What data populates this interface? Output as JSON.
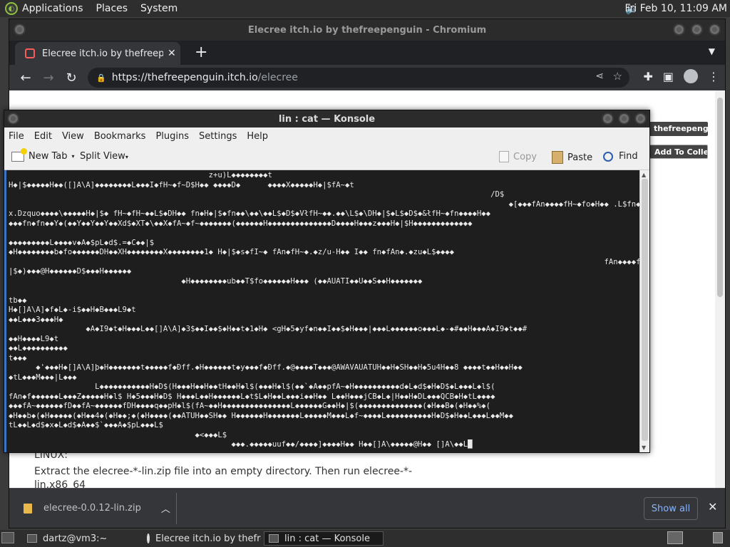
{
  "top_panel": {
    "menus": [
      "Applications",
      "Places",
      "System"
    ],
    "clock": "Fri Feb 10, 11:09 AM",
    "volume_icon": "speaker-icon"
  },
  "chrome": {
    "window_title": "Elecree itch.io by thefreepenguin - Chromium",
    "tab_title": "Elecree itch.io by thefreepenguin",
    "url_host": "https://thefreepenguin.itch.io",
    "url_path": "/elecree",
    "page": {
      "owner_button": "thefreepenguin",
      "collection_button": "Add To Collection",
      "linux_heading": "LINUX:",
      "extract_text": "Extract the elecree-*-lin.zip file into an empty directory. Then run elecree-*-lin.x86_64"
    },
    "downloads": {
      "file": "elecree-0.0.12-lin.zip",
      "show_all": "Show all"
    }
  },
  "konsole": {
    "title": "lin : cat — Konsole",
    "menu": [
      "File",
      "Edit",
      "View",
      "Bookmarks",
      "Plugins",
      "Settings",
      "Help"
    ],
    "toolbar": {
      "new_tab": "New Tab",
      "split_view": "Split View",
      "copy": "Copy",
      "paste": "Paste",
      "find": "Find"
    },
    "terminal_lines": [
      "                                            z+u)L◆◆◆◆◆◆◆◆t",
      "H◆|$◆◆◆◆◆H◆◆([]A\\A]◆◆◆◆◆◆◆◆L◆◆◆I◆fH~◆f~D$H◆◆ ◆◆◆◆D◆      ◆◆◆◆X◆◆◆◆◆H◆|$fA~◆t",
      "                                                                                                          /D$",
      "                                                                                                              ◆[◆◆◆fAn◆◆◆◆fH~◆fo◆H◆◆ .L$fn◆zzu",
      "x.Dzquo◆◆◆◆\\◆◆◆◆◆H◆|$◆ fH~◆fH~◆◆L$◆DH◆◆ fn◆H◆|$◆fn◆◆\\◆◆\\◆◆L$◆D$◆VłfH~◆◆.◆◆\\L$◆\\DH◆|$◆L$◆D$◆&łfH~◆fn◆◆◆◆H◆◆",
      "◆◆◆fn◆fn◆◆Y◆(◆◆Y◆◆Y◆◆Y◆◆Xd$◆XT◆\\◆◆X◆fA~◆f~◆◆◆◆◆◆◆(◆◆◆◆◆◆H◆◆◆◆◆◆◆◆◆◆◆◆◆◆D◆◆◆◆H◆◆◆z◆◆◆H◆|$H◆◆◆◆◆◆◆◆◆◆◆◆◆",
      "                                                                                                                                            ◆◆◆H◆|$◆◆◆",
      "◆◆◆◆◆◆◆◆◆L◆◆◆◆v◆A◆$pL◆d$.=◆C◆◆|$",
      "◆H◆◆◆◆◆◆◆◆b◆fo◆◆◆◆◆◆DH◆◆XH◆◆◆◆◆◆◆◆X◆◆◆◆◆◆◆◆1◆ H◆|$◆s◆fI~◆ fAn◆fH~◆.◆z/u-H◆◆ I◆◆ fn◆fAn◆.◆zu◆L$◆◆◆◆",
      "                                                                                                                                   fAn◆◆◆◆fA~◆H◆",
      "|$◆)◆◆◆@H◆◆◆◆◆◆D$◆◆◆H◆◆◆◆◆◆",
      "                                      ◆H◆◆◆◆◆◆◆◆ub◆◆T$fo◆◆◆◆◆◆H◆◆◆ (◆◆AUATI◆◆U◆◆S◆◆H◆◆◆◆◆◆◆",
      "",
      "tb◆◆",
      "H◆[]A\\A]◆f◆L◆-i$◆◆H◆B◆◆◆L9◆t",
      "◆◆L◆◆◆3◆◆◆H◆",
      "                 ◆A◆I9◆t◆H◆◆◆L◆◆[]A\\A]◆3$◆◆I◆◆$◆H◆◆t◆1◆H◆ <gH◆5◆yf◆n◆◆I◆◆$◆H◆◆◆|◆◆◆L◆◆◆◆◆◆o◆◆◆L◆-◆#◆◆H◆◆◆A◆I9◆t◆◆#",
      "◆◆H◆◆◆◆L9◆t",
      "◆◆L◆◆◆◆◆◆◆◆◆◆",
      "t◆◆◆",
      "      ◆'◆◆◆H◆[]A\\A]þ◆H◆◆◆◆◆◆◆t◆◆◆◆◆f◆Ðff.◆H◆◆◆◆◆◆t◆y◆◆◆f◆Ðff.◆@◆◆◆◆T◆◆◆@AWAVAUATUH◆◆H◆SH◆◆H◆5u4H◆◆8 ◆◆◆◆t◆◆H◆◆H◆◆",
      "◆tL◆◆◆M◆◆◆|L◆◆◆",
      "                   L◆◆◆◆◆◆◆◆◆◆◆H◆D$(H◆◆◆H◆◆H◆◆tH◆◆H◆l$(◆◆◆H◆l$(◆◆`◆A◆◆pfA~◆H◆◆◆◆◆◆◆◆◆◆d◆L◆d$◆H◆D$◆L◆◆◆L◆l$(",
      "fAn◆f◆◆◆◆◆◆L◆◆◆Z◆◆◆◆◆H◆l$ H◆5◆◆◆H◆D$ H◆◆◆L◆◆H◆◆◆◆◆◆L◆t$L◆H◆◆L◆◆◆i◆◆H◆◆ L◆◆H◆◆◆jCB◆L◆|H◆◆H◆DL◆◆◆QCB◆H◆tL◆◆◆◆",
      "◆◆◆fA~◆◆◆◆◆◆fD◆◆fA~◆◆◆◆◆◆fDH◆◆◆◆q◆◆pH◆l$(fA~◆◆H◆◆◆◆◆◆◆◆◆◆◆◆◆◆◆L◆◆◆◆◆◆G◆◆H◆|$(◆◆◆◆◆◆◆◆◆◆◆◆◆◆(◆H◆◆B◆(◆H◆◆%◆(",
      "◆H◆◆b◆(◆H◆◆◆◆◆(◆H◆◆4◆(◆H◆◆;◆(◆H◆◆◆◆(◆◆ATUH◆◆SH◆◆ H◆◆◆◆◆◆H◆◆◆◆◆◆◆L◆◆◆◆◆M◆◆◆L◆f~◆◆◆◆L◆◆◆◆◆◆◆◆◆◆H◆D$◆H◆◆L◆◆◆L◆◆M◆◆",
      "tL◆◆L◆d$◆x◆L◆d$◆A◆◆$`◆◆◆A◆$pL◆◆◆L$",
      "                                         ◆<◆◆◆L$",
      "                                                 ◆◆◆.◆◆◆◆◆uuf◆◆/◆◆◆◆]◆◆◆◆H◆◆ H◆◆[]A\\◆◆◆◆◆@H◆◆ []A\\◆◆L█"
    ]
  },
  "taskbar": {
    "tasks": [
      "dartz@vm3:~",
      "Elecree itch.io by thefreepenguin - Chromium",
      "lin : cat — Konsole"
    ]
  }
}
